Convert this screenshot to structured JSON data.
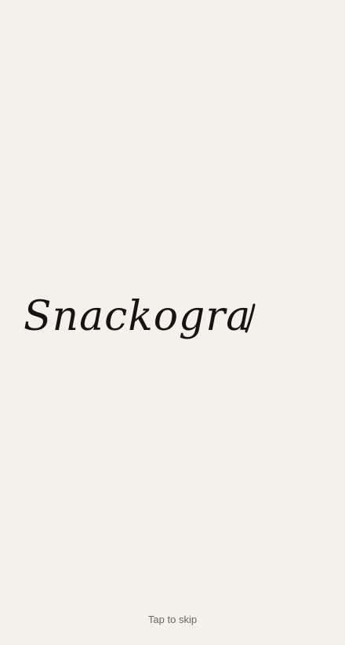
{
  "splash": {
    "logo_text": "Snackogra",
    "skip_label": "Tap to skip"
  },
  "colors": {
    "background": "#f6f0ea",
    "logo_ink": "#161412",
    "skip_text": "#6b6661"
  }
}
